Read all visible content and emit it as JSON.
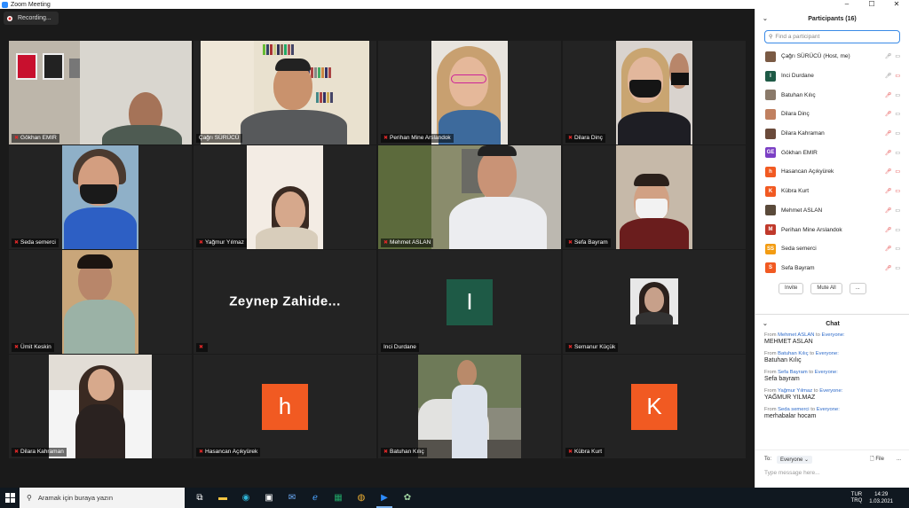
{
  "window": {
    "title": "Zoom Meeting",
    "controls": [
      "–",
      "☐",
      "✕"
    ]
  },
  "recording": {
    "label": "Recording..."
  },
  "tiles": [
    {
      "name": "Gökhan EMIR",
      "muted": true
    },
    {
      "name": "Çağrı SÜRÜCÜ",
      "muted": false
    },
    {
      "name": "Perihan Mine Arslandok",
      "muted": true
    },
    {
      "name": "Dilara Dinç",
      "muted": true
    },
    {
      "name": "Seda semerci",
      "muted": true
    },
    {
      "name": "Yağmur Yılmaz",
      "muted": true
    },
    {
      "name": "Mehmet ASLAN",
      "muted": true
    },
    {
      "name": "Sefa Bayram",
      "muted": true
    },
    {
      "name": "Ümit Keskin",
      "muted": true
    },
    {
      "name": "",
      "muted": true,
      "display_name": "Zeynep  Zahide..."
    },
    {
      "name": "Inci Durdane",
      "muted": false,
      "avatar_letter": "I",
      "avatar_color": "#1e5a46"
    },
    {
      "name": "Semanur Küçük",
      "muted": true
    },
    {
      "name": "Dilara Kahraman",
      "muted": true
    },
    {
      "name": "Hasancan Açıkyürek",
      "muted": true,
      "avatar_letter": "h",
      "avatar_color": "#f15a22"
    },
    {
      "name": "Batuhan Kılıç",
      "muted": true
    },
    {
      "name": "Kübra Kurt",
      "muted": true,
      "avatar_letter": "K",
      "avatar_color": "#f15a22"
    }
  ],
  "participants": {
    "title": "Participants (16)",
    "search_placeholder": "Find a participant",
    "list": [
      {
        "name": "Çağrı SÜRÜCÜ (Host, me)",
        "avatar": "",
        "color": "#7a5a44",
        "mic": "on",
        "video": "on"
      },
      {
        "name": "Inci Durdane",
        "avatar": "I",
        "color": "#1e5a46",
        "mic": "on",
        "video": "off"
      },
      {
        "name": "Batuhan Kılıç",
        "avatar": "",
        "color": "#8a7a6a",
        "mic": "off",
        "video": "on"
      },
      {
        "name": "Dilara Dinç",
        "avatar": "",
        "color": "#c08060",
        "mic": "off",
        "video": "on"
      },
      {
        "name": "Dilara Kahraman",
        "avatar": "",
        "color": "#6a4a3a",
        "mic": "off",
        "video": "on"
      },
      {
        "name": "Gökhan EMIR",
        "avatar": "GE",
        "color": "#7b3fc4",
        "mic": "off",
        "video": "on"
      },
      {
        "name": "Hasancan Açıkyürek",
        "avatar": "h",
        "color": "#f15a22",
        "mic": "off",
        "video": "off"
      },
      {
        "name": "Kübra Kurt",
        "avatar": "K",
        "color": "#f15a22",
        "mic": "off",
        "video": "off"
      },
      {
        "name": "Mehmet ASLAN",
        "avatar": "",
        "color": "#5a4a3a",
        "mic": "off",
        "video": "on"
      },
      {
        "name": "Perihan Mine Arslandok",
        "avatar": "M",
        "color": "#c0392b",
        "mic": "off",
        "video": "on"
      },
      {
        "name": "Seda semerci",
        "avatar": "SS",
        "color": "#f39c12",
        "mic": "off",
        "video": "on"
      },
      {
        "name": "Sefa Bayram",
        "avatar": "S",
        "color": "#f15a22",
        "mic": "off",
        "video": "on"
      }
    ],
    "invite_label": "Invite",
    "mute_all_label": "Mute All",
    "more_label": "..."
  },
  "chat": {
    "title": "Chat",
    "messages": [
      {
        "from_prefix": "From",
        "sender": "Mehmet ASLAN",
        "to_word": "to",
        "recipient": "Everyone:",
        "text": "MEHMET ASLAN"
      },
      {
        "from_prefix": "From",
        "sender": "Batuhan Kılıç",
        "to_word": "to",
        "recipient": "Everyone:",
        "text": "Batuhan Kılıç"
      },
      {
        "from_prefix": "From",
        "sender": "Sefa Bayram",
        "to_word": "to",
        "recipient": "Everyone:",
        "text": "Sefa bayram"
      },
      {
        "from_prefix": "From",
        "sender": "Yağmur Yılmaz",
        "to_word": "to",
        "recipient": "Everyone:",
        "text": "YAĞMUR YILMAZ"
      },
      {
        "from_prefix": "From",
        "sender": "Seda semerci",
        "to_word": "to",
        "recipient": "Everyone:",
        "text": "merhabalar hocam"
      }
    ],
    "to_label": "To:",
    "recipient_select": "Everyone ⌄",
    "file_label": "File",
    "more_label": "...",
    "input_placeholder": "Type message here..."
  },
  "taskbar": {
    "search_placeholder": "Aramak için buraya yazın",
    "lang_top": "TUR",
    "lang_bottom": "TRQ",
    "time": "14:29",
    "date": "1.03.2021"
  }
}
